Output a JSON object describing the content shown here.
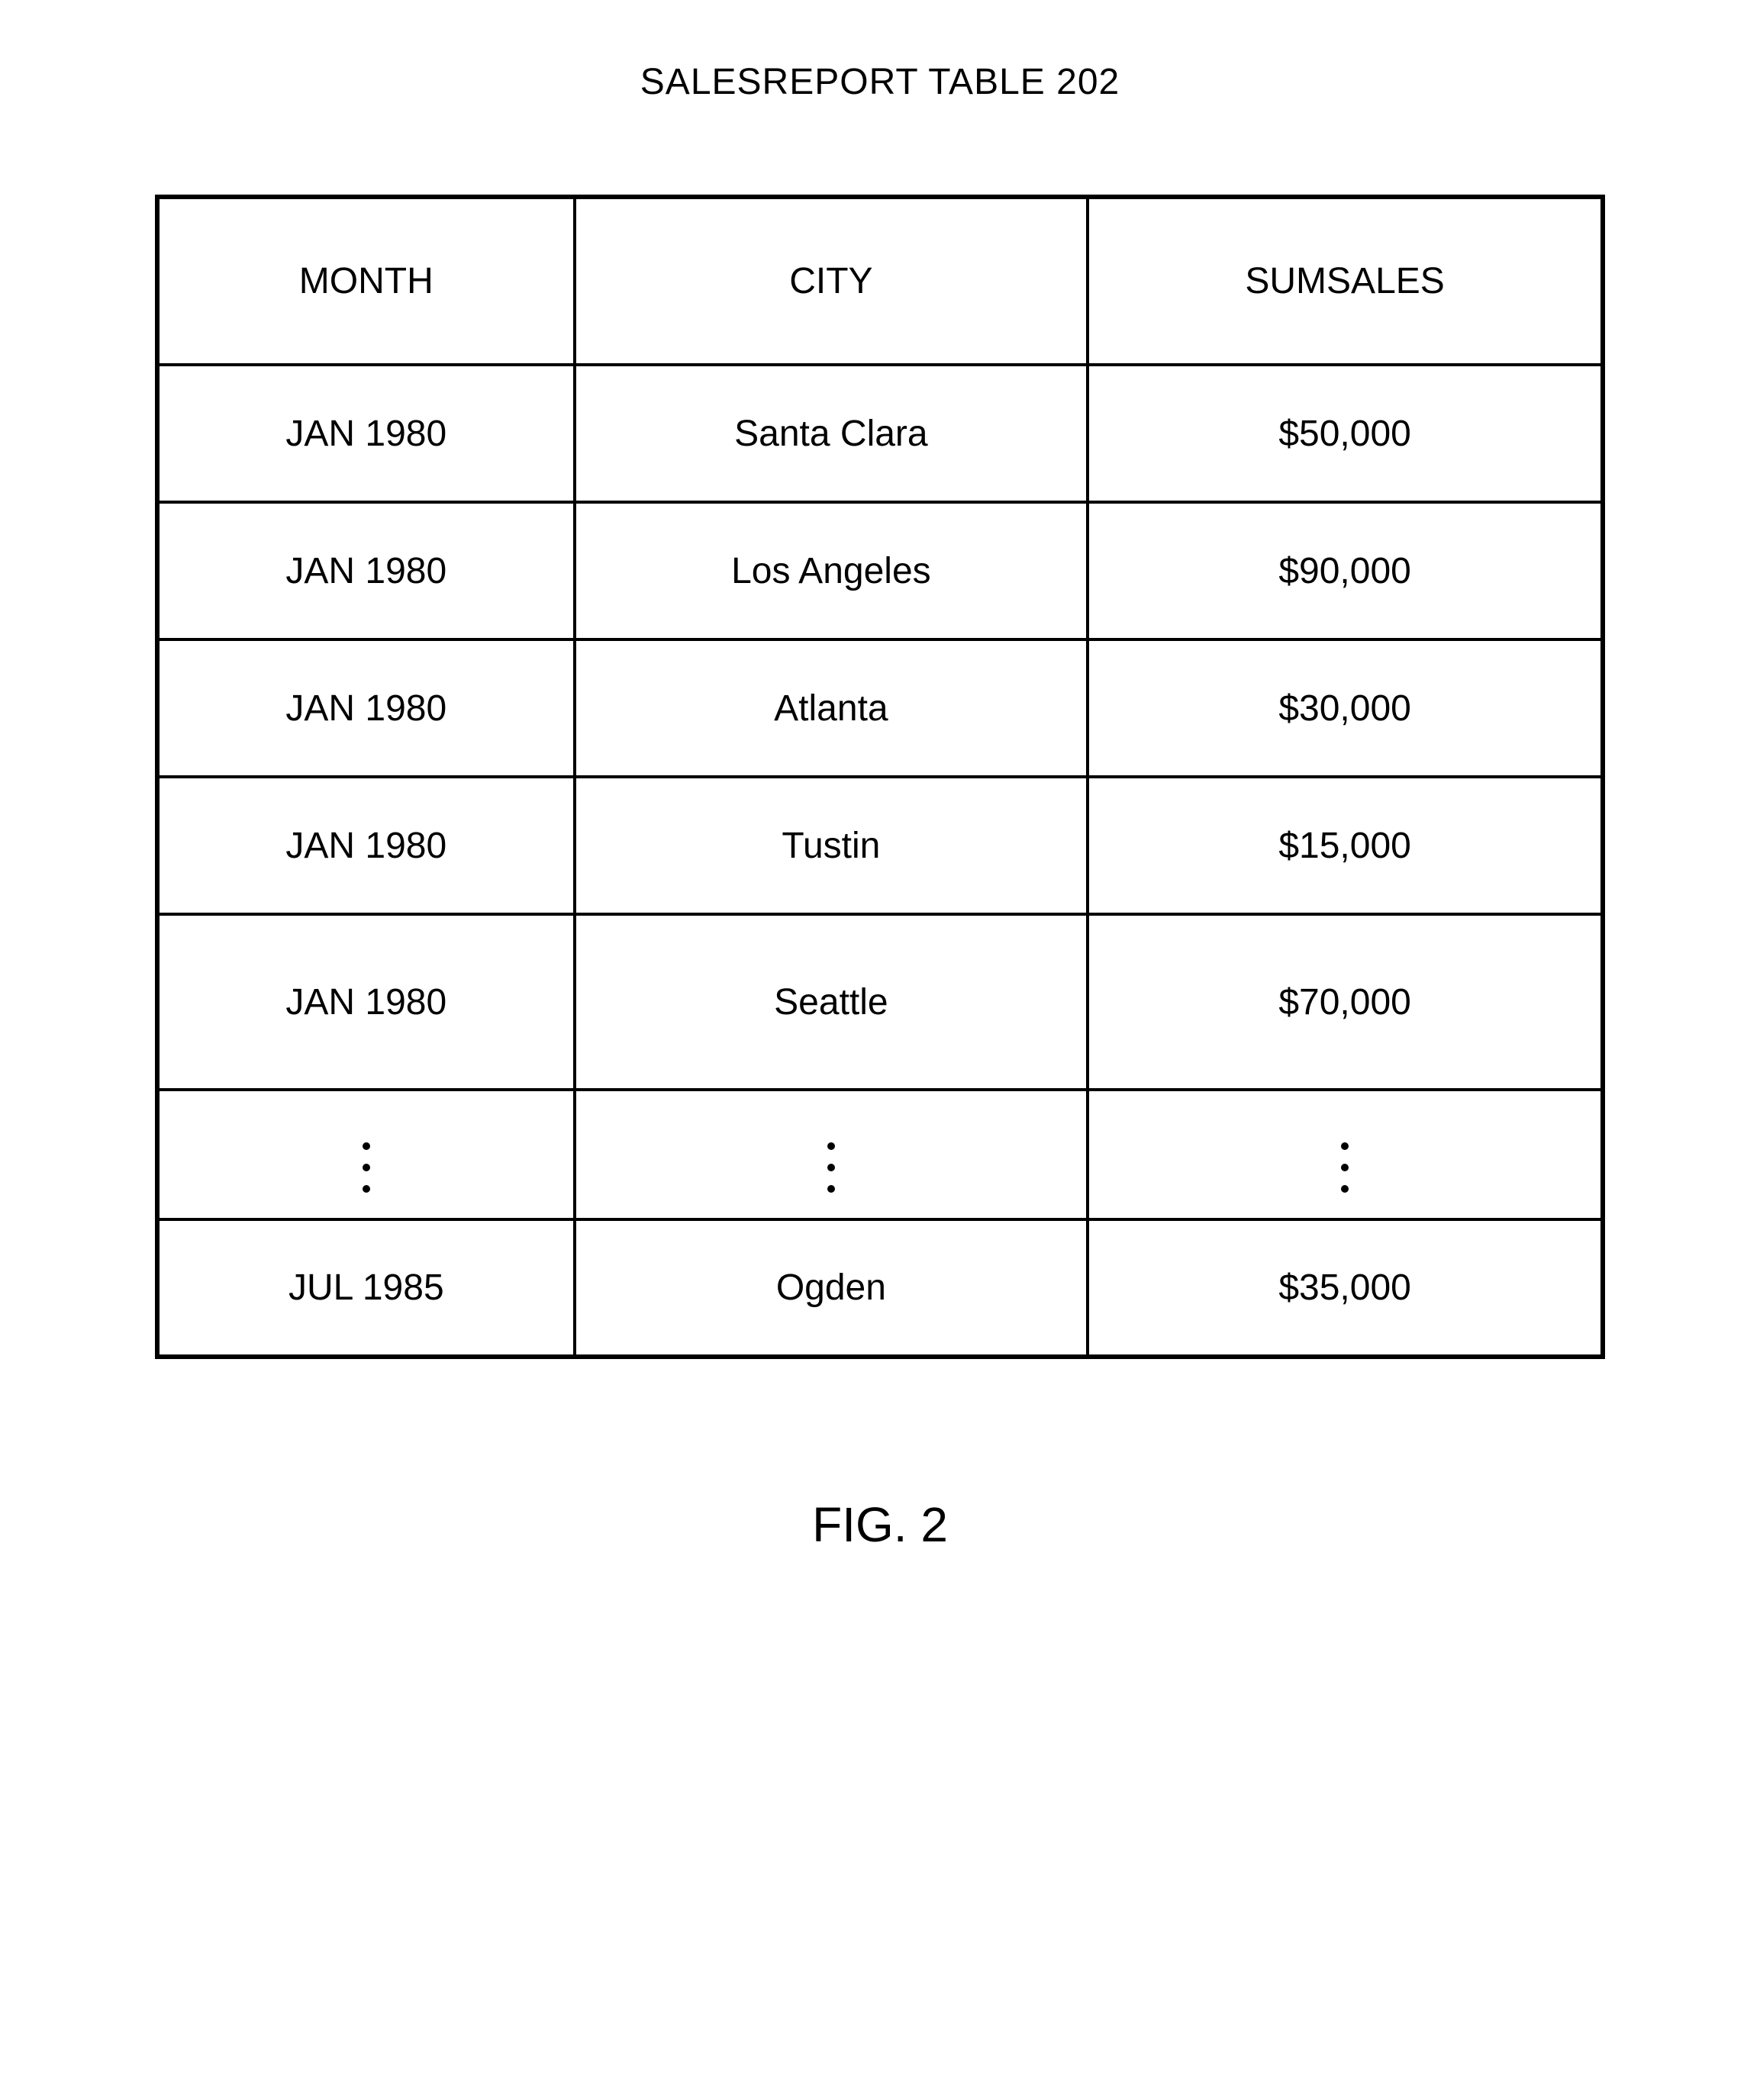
{
  "title": "SALESREPORT TABLE 202",
  "figure_label": "FIG. 2",
  "table": {
    "headers": [
      "MONTH",
      "CITY",
      "SUMSALES"
    ],
    "rows": [
      {
        "month": "JAN 1980",
        "city": "Santa Clara",
        "sumsales": "$50,000"
      },
      {
        "month": "JAN 1980",
        "city": "Los Angeles",
        "sumsales": "$90,000"
      },
      {
        "month": "JAN 1980",
        "city": "Atlanta",
        "sumsales": "$30,000"
      },
      {
        "month": "JAN 1980",
        "city": "Tustin",
        "sumsales": "$15,000"
      },
      {
        "month": "JAN 1980",
        "city": "Seattle",
        "sumsales": "$70,000"
      },
      {
        "ellipsis": true
      },
      {
        "month": "JUL 1985",
        "city": "Ogden",
        "sumsales": "$35,000"
      }
    ]
  }
}
